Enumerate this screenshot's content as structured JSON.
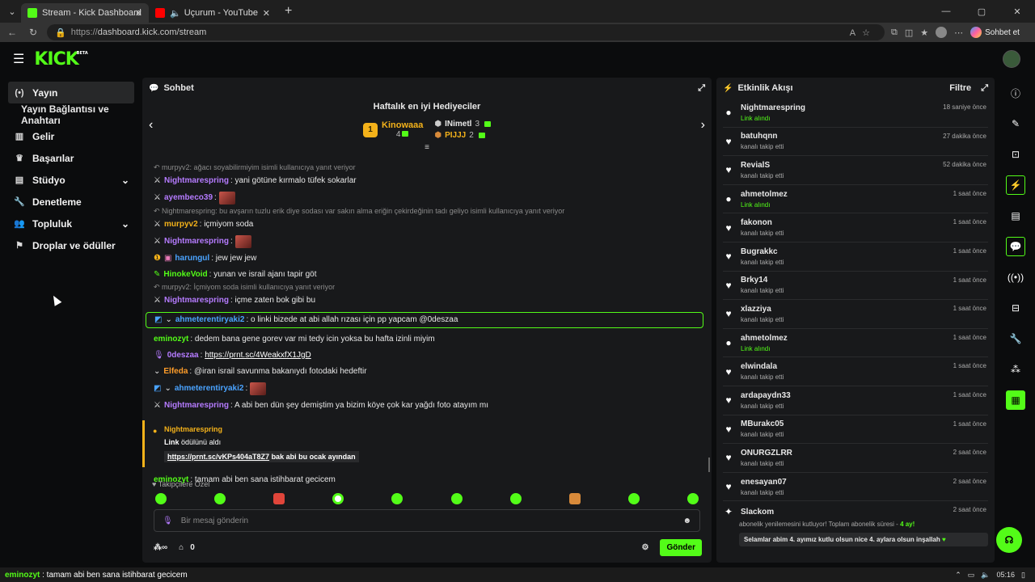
{
  "browser": {
    "tabs": [
      {
        "title": "Stream - Kick Dashboard",
        "color": "#53fc18"
      },
      {
        "title": "Uçurum - YouTube",
        "color": "#ff0000"
      }
    ],
    "url_prefix": "https://",
    "url": "dashboard.kick.com/stream",
    "copilot_label": "Sohbet et"
  },
  "app": {
    "logo": "KICK",
    "logo_badge": "BETA"
  },
  "sidebar": {
    "items": [
      {
        "label": "Yayın",
        "icon": "broadcast-icon"
      },
      {
        "label": "Yayın Bağlantısı ve Anahtarı",
        "icon": ""
      },
      {
        "label": "Gelir",
        "icon": "chart-icon"
      },
      {
        "label": "Başarılar",
        "icon": "trophy-icon"
      },
      {
        "label": "Stüdyo",
        "icon": "studio-icon"
      },
      {
        "label": "Denetleme",
        "icon": "wrench-icon"
      },
      {
        "label": "Topluluk",
        "icon": "people-icon"
      },
      {
        "label": "Droplar ve ödüller",
        "icon": "gift-icon"
      }
    ]
  },
  "chat": {
    "title": "Sohbet",
    "top_gifters_title": "Haftalık en iyi Hediyeciler",
    "gifters": [
      {
        "rank": "1",
        "name": "Kinowaaa",
        "count": "4"
      },
      {
        "name": "INimetl",
        "count": "3"
      },
      {
        "name": "PIJJJ",
        "count": "2"
      }
    ],
    "messages": [
      {
        "reply": "murpyv2: ağacı soyabilirmiyim isimli kullanıcıya yanıt veriyor"
      },
      {
        "user": "Nightmarespring",
        "text": ": yani götüne kırmalo tüfek sokarlar"
      },
      {
        "user": "ayembeco39",
        "text": ":"
      },
      {
        "reply": "Nightmarespring: bu avşarın tuzlu erik diye sodası var sakın alma eriğin çekirdeğinin tadı geliyo isimli kullanıcıya yanıt veriyor"
      },
      {
        "user": "murpyv2",
        "text": ": içmiyom soda"
      },
      {
        "user": "Nightmarespring",
        "text": ":"
      },
      {
        "user": "harungul",
        "text": ": jew jew jew"
      },
      {
        "user": "HinokeVoid",
        "text": ": yunan ve israil ajanı tapir göt"
      },
      {
        "reply": "murpyv2: İçmiyom soda isimli kullanıcıya yanıt veriyor"
      },
      {
        "user": "Nightmarespring",
        "text": ": içme zaten bok gibi bu"
      },
      {
        "user": "ahmeterentiryaki2",
        "text": ": o linki bizede at abi allah rızası için pp yapcam @0deszaa"
      },
      {
        "user": "eminozyt",
        "text": ": dedem bana gene gorev var mi tedy icin yoksa bu hafta izinli miyim"
      },
      {
        "user": "0deszaa",
        "text": ":",
        "link": "https://prnt.sc/4WeakxfX1JgD"
      },
      {
        "user": "Elfeda",
        "text": ": @iran israil savunma bakanıydı fotodaki hedeftir"
      },
      {
        "user": "ahmeterentiryaki2",
        "text": ":"
      },
      {
        "user": "Nightmarespring",
        "text": ": A abi ben dün şey demiştim ya bizim köye çok kar yağdı foto atayım mı"
      },
      {
        "user": "eminozyt",
        "text": ": tamam abi ben sana istihbarat gecicem"
      }
    ],
    "redeem": {
      "user": "Nightmarespring",
      "reward": "Link",
      "reward_suffix": "ödülünü aldı",
      "link": "https://prnt.sc/vKPs404aT8Z7",
      "note": "bak abi bu ocak ayından"
    },
    "followers_only": "Takipçilere Özel",
    "input_placeholder": "Bir mesaj gönderin",
    "footer_count": "0",
    "send_label": "Gönder"
  },
  "activity": {
    "title": "Etkinlik Akışı",
    "filter": "Filtre",
    "events": [
      {
        "user": "Nightmarespring",
        "event": "Link alındı",
        "time": "18 saniye önce",
        "type": "reward"
      },
      {
        "user": "batuhqnn",
        "event": "kanalı takip etti",
        "time": "27 dakika önce",
        "type": "follow"
      },
      {
        "user": "RevialS",
        "event": "kanalı takip etti",
        "time": "52 dakika önce",
        "type": "follow"
      },
      {
        "user": "ahmetolmez",
        "event": "Link alındı",
        "time": "1 saat önce",
        "type": "reward"
      },
      {
        "user": "fakonon",
        "event": "kanalı takip etti",
        "time": "1 saat önce",
        "type": "follow"
      },
      {
        "user": "Bugrakkc",
        "event": "kanalı takip etti",
        "time": "1 saat önce",
        "type": "follow"
      },
      {
        "user": "Brky14",
        "event": "kanalı takip etti",
        "time": "1 saat önce",
        "type": "follow"
      },
      {
        "user": "xlazziya",
        "event": "kanalı takip etti",
        "time": "1 saat önce",
        "type": "follow"
      },
      {
        "user": "ahmetolmez",
        "event": "Link alındı",
        "time": "1 saat önce",
        "type": "reward"
      },
      {
        "user": "elwindala",
        "event": "kanalı takip etti",
        "time": "1 saat önce",
        "type": "follow"
      },
      {
        "user": "ardapaydn33",
        "event": "kanalı takip etti",
        "time": "1 saat önce",
        "type": "follow"
      },
      {
        "user": "MBurakc05",
        "event": "kanalı takip etti",
        "time": "1 saat önce",
        "type": "follow"
      },
      {
        "user": "ONURGZLRR",
        "event": "kanalı takip etti",
        "time": "2 saat önce",
        "type": "follow"
      },
      {
        "user": "enesayan07",
        "event": "kanalı takip etti",
        "time": "2 saat önce",
        "type": "follow"
      }
    ],
    "sub": {
      "user": "Slackom",
      "time": "2 saat önce",
      "text": "abonelik yenilemesini kutluyor! Toplam abonelik süresi - ",
      "months": "4 ay!",
      "message": "Selamlar abim 4. ayımız kutlu olsun nice 4. aylara olsun inşallah"
    }
  },
  "taskbar": {
    "user": "eminozyt",
    "text": " : tamam abi ben sana istihbarat gecicem",
    "time": "05:16"
  }
}
